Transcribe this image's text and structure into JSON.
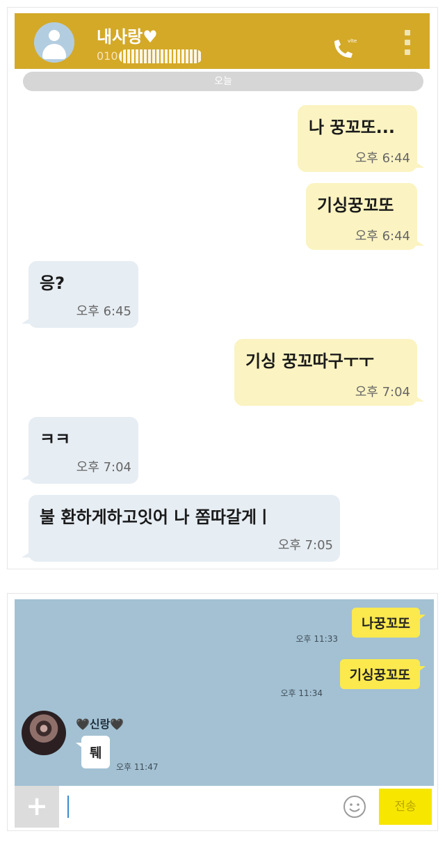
{
  "screen1": {
    "header": {
      "contact_name": "내사랑♥",
      "phone_prefix": "010",
      "header_color": "#d4a927"
    },
    "date_label": "오늘",
    "messages": [
      {
        "side": "sent",
        "text": "나 꿍꼬또...",
        "time": "오후 6:44"
      },
      {
        "side": "sent",
        "text": "기싱꿍꼬또",
        "time": "오후 6:44"
      },
      {
        "side": "received",
        "text": "응?",
        "time": "오후 6:45"
      },
      {
        "side": "sent",
        "text": "기싱 꿍꼬따구ㅜㅜ",
        "time": "오후 7:04"
      },
      {
        "side": "received",
        "text": "ㅋㅋ",
        "time": "오후 7:04"
      },
      {
        "side": "received",
        "text": "불 환하게하고잇어 나 쫌따갈게ㅣ",
        "time": "오후 7:05"
      }
    ]
  },
  "screen2": {
    "background_color": "#a3c1d3",
    "messages": [
      {
        "side": "sent",
        "text": "나꿍꼬또",
        "time": "오후 11:33"
      },
      {
        "side": "sent",
        "text": "기싱꿍꼬또",
        "time": "오후 11:34"
      },
      {
        "side": "received",
        "sender": "🖤신랑🖤",
        "text": "퉤",
        "time": "오후 11:47"
      }
    ],
    "input": {
      "value": "",
      "send_label": "전송"
    }
  }
}
